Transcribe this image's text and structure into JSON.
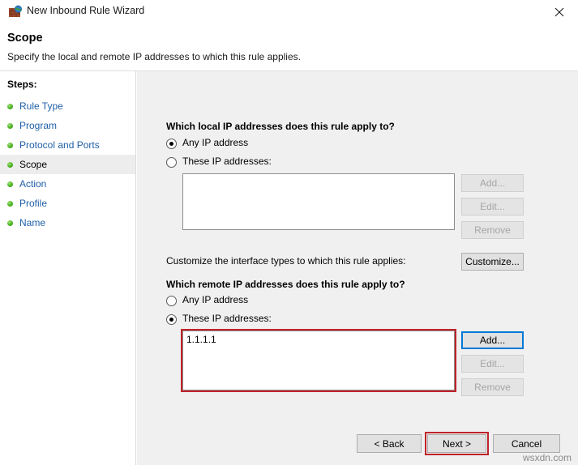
{
  "window": {
    "title": "New Inbound Rule Wizard",
    "icon": "firewall-globe-icon",
    "close_label": "×"
  },
  "header": {
    "title": "Scope",
    "subtitle": "Specify the local and remote IP addresses to which this rule applies."
  },
  "sidebar": {
    "header": "Steps:",
    "items": [
      {
        "label": "Rule Type",
        "current": false
      },
      {
        "label": "Program",
        "current": false
      },
      {
        "label": "Protocol and Ports",
        "current": false
      },
      {
        "label": "Scope",
        "current": true
      },
      {
        "label": "Action",
        "current": false
      },
      {
        "label": "Profile",
        "current": false
      },
      {
        "label": "Name",
        "current": false
      }
    ]
  },
  "local": {
    "question": "Which local IP addresses does this rule apply to?",
    "option_any": "Any IP address",
    "option_these": "These IP addresses:",
    "selected": "any",
    "list_items": [],
    "buttons": {
      "add": "Add...",
      "edit": "Edit...",
      "remove": "Remove"
    }
  },
  "interface": {
    "label": "Customize the interface types to which this rule applies:",
    "button": "Customize..."
  },
  "remote": {
    "question": "Which remote IP addresses does this rule apply to?",
    "option_any": "Any IP address",
    "option_these": "These IP addresses:",
    "selected": "these",
    "list_items": [
      "1.1.1.1"
    ],
    "buttons": {
      "add": "Add...",
      "edit": "Edit...",
      "remove": "Remove"
    }
  },
  "footer": {
    "back": "< Back",
    "next": "Next >",
    "cancel": "Cancel"
  },
  "watermark": "wsxdn.com",
  "colors": {
    "annotation_red": "#c0232a",
    "focus_blue": "#0078d7",
    "link_blue": "#1f5fa8",
    "panel_grey": "#f0f0f0"
  }
}
